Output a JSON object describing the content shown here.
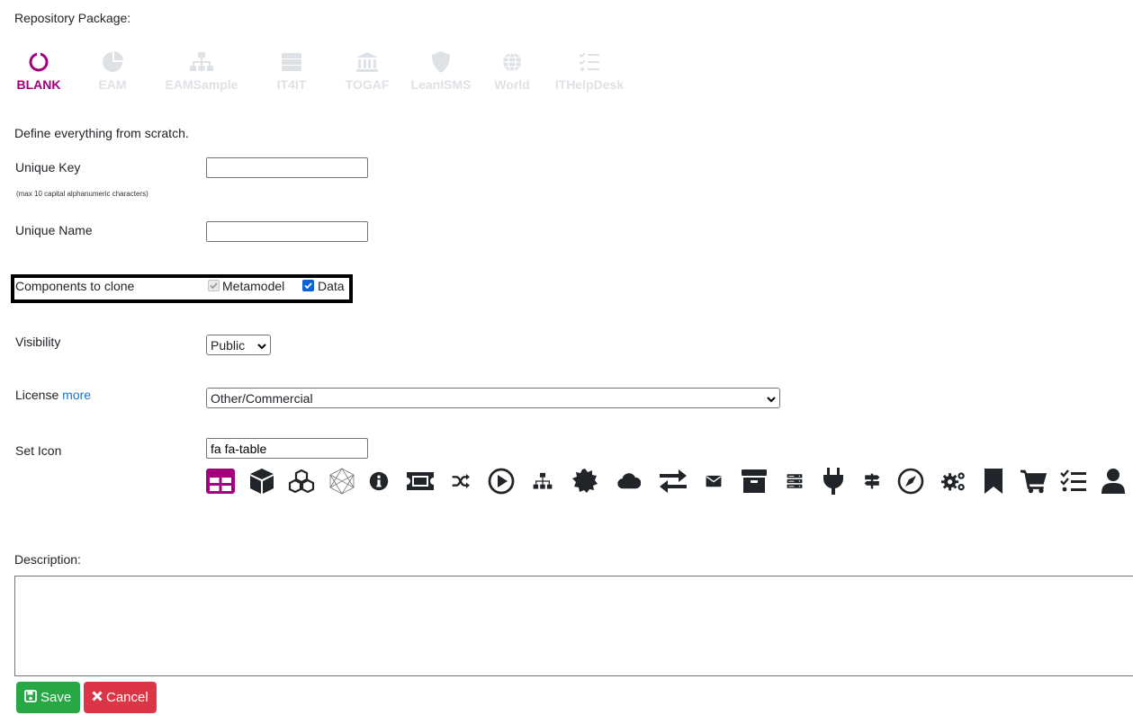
{
  "repo_label": "Repository Package:",
  "packages": [
    {
      "name": "BLANK",
      "icon": "circle-notch-icon",
      "active": true
    },
    {
      "name": "EAM",
      "icon": "chart-pie-icon"
    },
    {
      "name": "EAMSample",
      "icon": "sitemap-icon"
    },
    {
      "name": "IT4IT",
      "icon": "server-icon"
    },
    {
      "name": "TOGAF",
      "icon": "landmark-icon"
    },
    {
      "name": "LeanISMS",
      "icon": "shield-icon"
    },
    {
      "name": "World",
      "icon": "globe-icon"
    },
    {
      "name": "ITHelpDesk",
      "icon": "tasks-icon"
    }
  ],
  "package_description": "Define everything from scratch.",
  "form": {
    "unique_key_label": "Unique Key",
    "unique_key_hint": "(max 10 capital alphanumeric characters)",
    "unique_key_value": "",
    "unique_name_label": "Unique Name",
    "unique_name_value": "",
    "components_label": "Components to clone",
    "metamodel_label": "Metamodel",
    "metamodel_checked": true,
    "metamodel_disabled": true,
    "data_label": "Data",
    "data_checked": true,
    "visibility_label": "Visibility",
    "visibility_value": "Public",
    "license_label": "License",
    "license_more": "more",
    "license_value": "Other/Commercial",
    "set_icon_label": "Set Icon",
    "icon_value": "fa fa-table",
    "description_label": "Description:",
    "description_value": ""
  },
  "icon_choices": [
    "table-icon",
    "cube-icon",
    "cubes-icon",
    "hexagon-outline-icon",
    "info-circle-icon",
    "ticket-icon",
    "random-icon",
    "play-circle-icon",
    "sitemap-icon",
    "certificate-icon",
    "cloud-icon",
    "exchange-icon",
    "envelope-icon",
    "archive-icon",
    "server-icon",
    "plug-icon",
    "signs-icon",
    "compass-icon",
    "cogs-icon",
    "bookmark-icon",
    "shopping-cart-icon",
    "tasks-icon",
    "user-icon"
  ],
  "buttons": {
    "save": "Save",
    "cancel": "Cancel"
  },
  "colors": {
    "accent": "#a2007d",
    "save": "#28a745",
    "cancel": "#dc3545",
    "link": "#1a73c8",
    "inactive": "#dee2e6"
  }
}
